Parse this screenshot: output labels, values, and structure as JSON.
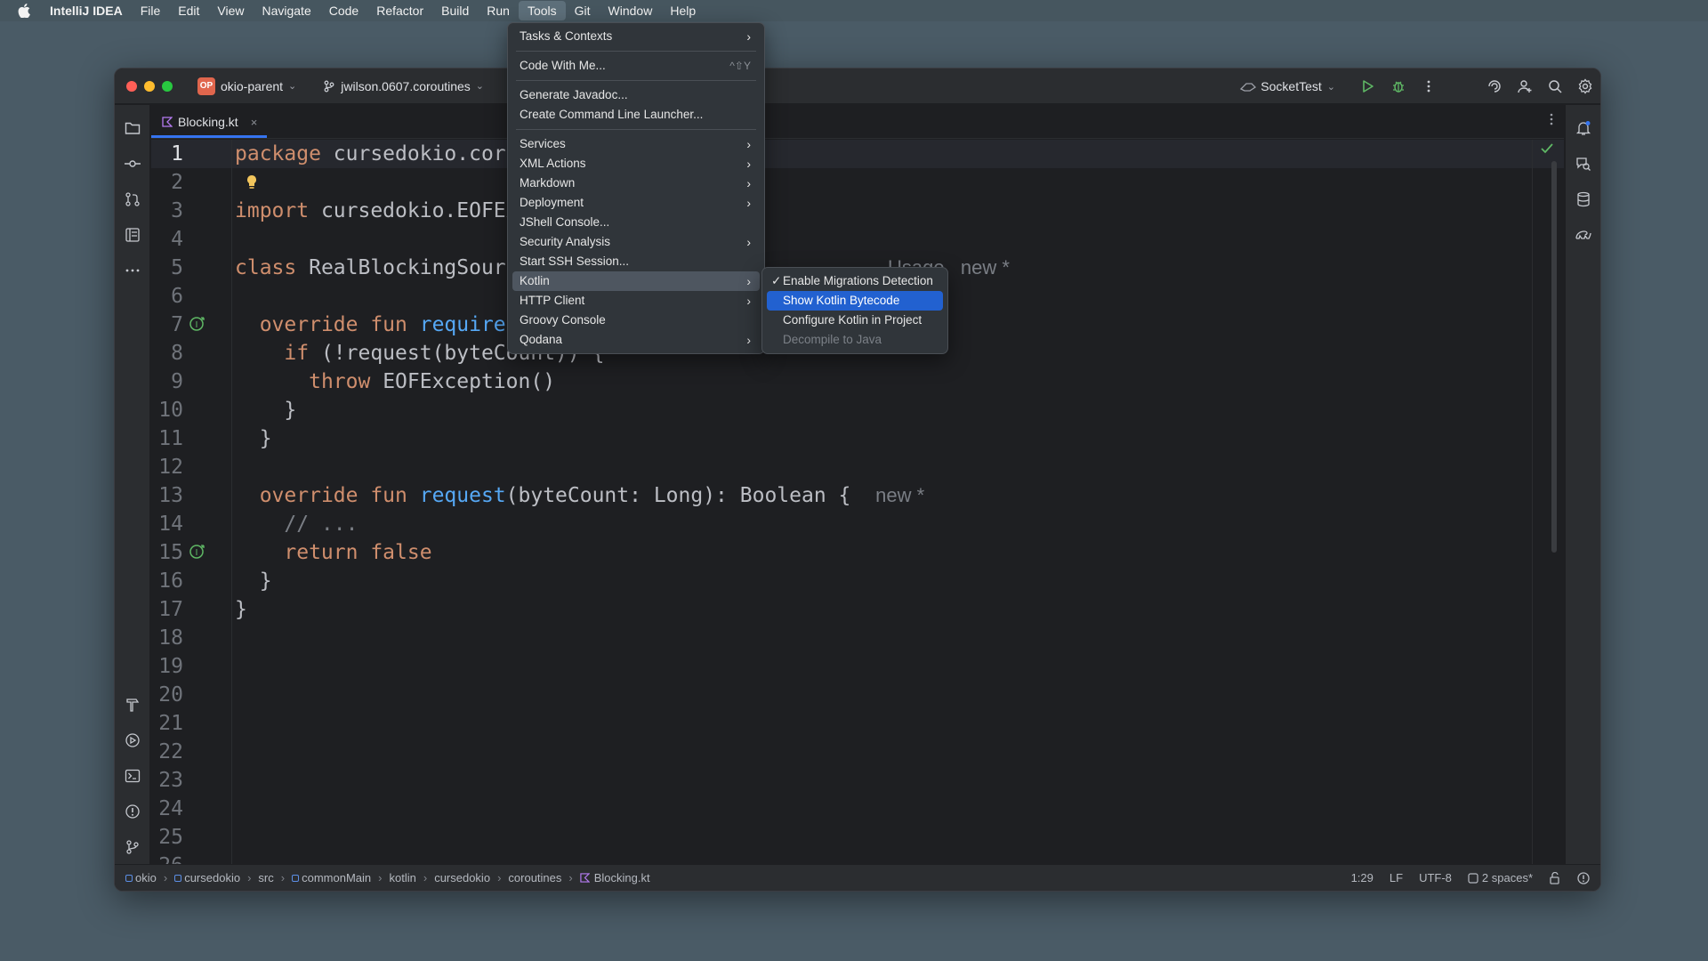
{
  "menubar": {
    "app_name": "IntelliJ IDEA",
    "items": [
      "File",
      "Edit",
      "View",
      "Navigate",
      "Code",
      "Refactor",
      "Build",
      "Run",
      "Tools",
      "Git",
      "Window",
      "Help"
    ],
    "active_item": "Tools"
  },
  "window": {
    "project_badge": "OP",
    "project_name": "okio-parent",
    "branch": "jwilson.0607.coroutines",
    "run_config": "SocketTest"
  },
  "editor": {
    "tab": {
      "label": "Blocking.kt",
      "close": "×"
    },
    "line_numbers": [
      "1",
      "2",
      "3",
      "4",
      "5",
      "6",
      "7",
      "8",
      "9",
      "10",
      "11",
      "12",
      "13",
      "14",
      "15",
      "16",
      "17",
      "18",
      "19",
      "20",
      "21",
      "22",
      "23",
      "24",
      "25",
      "26"
    ],
    "lines": {
      "l1_kw": "package",
      "l1_rest": " cursedokio.coro",
      "l3_kw": "import",
      "l3_rest": " cursedokio.EOFEx",
      "l5_kw": "class",
      "l5_rest": " RealBlockingSourc",
      "l5_hint": "Usage   new *",
      "l7_kw": "override fun",
      "l7_fn": " require(",
      "l8_kw": "if",
      "l8_rest": " (!request(byteCount)) {",
      "l9_kw": "throw",
      "l9_rest": " EOFException()",
      "l10": "}",
      "l11": "}",
      "l13_kw": "override fun",
      "l13_fn": " request",
      "l13_rest": "(byteCount: Long): Boolean {",
      "l13_hint": "new *",
      "l14": "// ...",
      "l15_kw": "return false",
      "l16": "}",
      "l17": "}"
    }
  },
  "tools_menu": {
    "items": [
      {
        "label": "Tasks & Contexts",
        "submenu": true
      },
      {
        "label": "Code With Me...",
        "shortcut": "^⇧Y"
      },
      {
        "label": "Generate Javadoc..."
      },
      {
        "label": "Create Command Line Launcher..."
      },
      {
        "label": "Services",
        "submenu": true
      },
      {
        "label": "XML Actions",
        "submenu": true
      },
      {
        "label": "Markdown",
        "submenu": true
      },
      {
        "label": "Deployment",
        "submenu": true
      },
      {
        "label": "JShell Console..."
      },
      {
        "label": "Security Analysis",
        "submenu": true
      },
      {
        "label": "Start SSH Session..."
      },
      {
        "label": "Kotlin",
        "submenu": true,
        "highlighted": true
      },
      {
        "label": "HTTP Client",
        "submenu": true
      },
      {
        "label": "Groovy Console"
      },
      {
        "label": "Qodana",
        "submenu": true
      }
    ]
  },
  "kotlin_submenu": {
    "items": [
      {
        "label": "Enable Migrations Detection",
        "checked": true
      },
      {
        "label": "Show Kotlin Bytecode",
        "selected": true
      },
      {
        "label": "Configure Kotlin in Project"
      },
      {
        "label": "Decompile to Java",
        "disabled": true
      }
    ]
  },
  "statusbar": {
    "breadcrumbs": [
      "okio",
      "cursedokio",
      "src",
      "commonMain",
      "kotlin",
      "cursedokio",
      "coroutines",
      "Blocking.kt"
    ],
    "position": "1:29",
    "line_ending": "LF",
    "encoding": "UTF-8",
    "indent": "2 spaces*"
  },
  "colors": {
    "accent": "#3574f0",
    "selection": "#2261d0",
    "keyword": "#cf8e6d",
    "function": "#56a8f5"
  }
}
